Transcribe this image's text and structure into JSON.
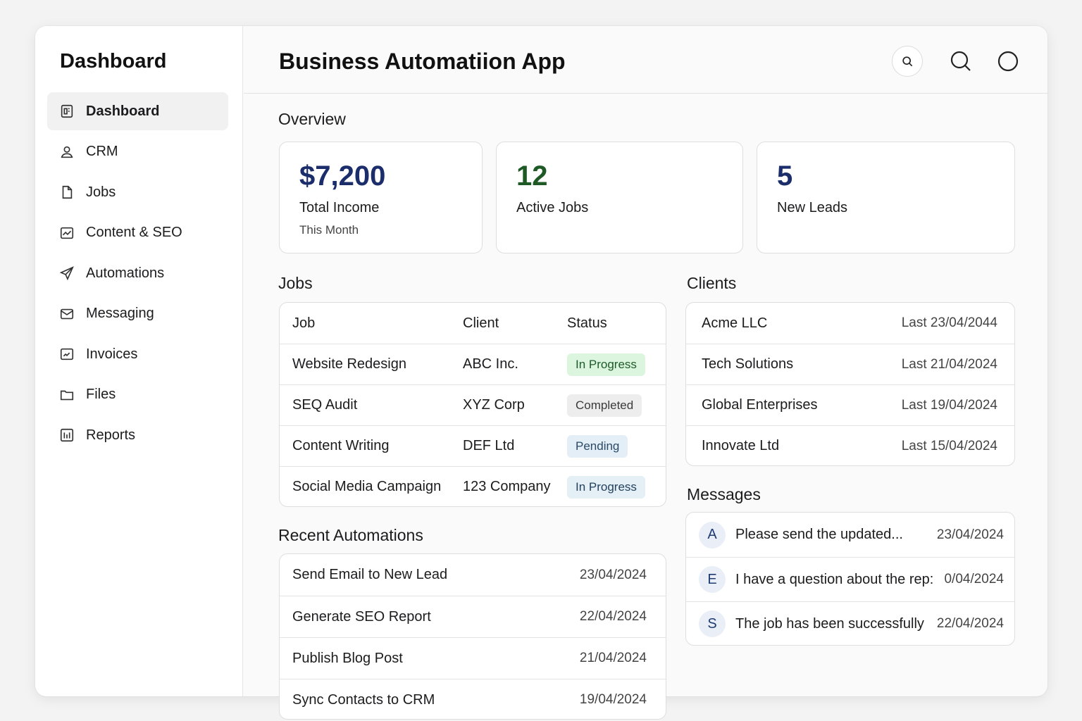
{
  "sidebar": {
    "title": "Dashboard",
    "items": [
      {
        "label": "Dashboard",
        "icon": "dashboard-icon",
        "active": true
      },
      {
        "label": "CRM",
        "icon": "user-icon"
      },
      {
        "label": "Jobs",
        "icon": "document-icon"
      },
      {
        "label": "Content & SEO",
        "icon": "chart-icon"
      },
      {
        "label": "Automations",
        "icon": "send-icon"
      },
      {
        "label": "Messaging",
        "icon": "mail-icon"
      },
      {
        "label": "Invoices",
        "icon": "invoice-icon"
      },
      {
        "label": "Files",
        "icon": "folder-icon"
      },
      {
        "label": "Reports",
        "icon": "reports-icon"
      }
    ]
  },
  "header": {
    "title": "Business Automatiion App",
    "icons": [
      "search-icon",
      "search-icon",
      "profile-icon"
    ]
  },
  "overview": {
    "title": "Overview",
    "cards": [
      {
        "value": "$7,200",
        "label": "Total Income",
        "sub": "This Month",
        "color": "#1b2e6b"
      },
      {
        "value": "12",
        "label": "Active Jobs",
        "sub": "",
        "color": "#1f5a26"
      },
      {
        "value": "5",
        "label": "New Leads",
        "sub": "",
        "color": "#1b2e6b"
      }
    ]
  },
  "jobs": {
    "title": "Jobs",
    "headers": [
      "Job",
      "Client",
      "Status"
    ],
    "rows": [
      {
        "job": "Website Redesign",
        "client": "ABC Inc.",
        "status": "In Progress"
      },
      {
        "job": "SEQ Audit",
        "client": "XYZ Corp",
        "status": "Completed"
      },
      {
        "job": "Content Writing",
        "client": "DEF Ltd",
        "status": "Pending"
      },
      {
        "job": "Social Media Campaign",
        "client": "123 Company",
        "status": "In Progress"
      }
    ]
  },
  "clients": {
    "title": "Clients",
    "rows": [
      {
        "name": "Acme LLC",
        "last": "Last 23/04/2044"
      },
      {
        "name": "Tech Solutions",
        "last": "Last 21/04/2024"
      },
      {
        "name": "Global Enterprises",
        "last": "Last 19/04/2024"
      },
      {
        "name": "Innovate Ltd",
        "last": "Last 15/04/2024"
      }
    ]
  },
  "automations": {
    "title": "Recent Automations",
    "rows": [
      {
        "name": "Send Email to New Lead",
        "date": "23/04/2024"
      },
      {
        "name": "Generate SEO Report",
        "date": "22/04/2024"
      },
      {
        "name": "Publish Blog Post",
        "date": "21/04/2024"
      },
      {
        "name": "Sync Contacts to CRM",
        "date": "19/04/2024"
      }
    ]
  },
  "messages": {
    "title": "Messages",
    "rows": [
      {
        "initial": "A",
        "text": "Please send the updated...",
        "date": "23/04/2024"
      },
      {
        "initial": "E",
        "text": "I have a question about the rep:",
        "date": "0/04/2024"
      },
      {
        "initial": "S",
        "text": "The job has been successfully",
        "date": "22/04/2024"
      }
    ]
  }
}
